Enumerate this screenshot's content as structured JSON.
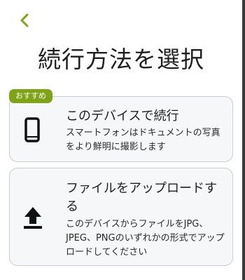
{
  "header": {
    "title": "続行方法を選択"
  },
  "options": [
    {
      "badge": "おすすめ",
      "title": "このデバイスで続行",
      "description": "スマートフォンはドキュメントの写真をより鮮明に撮影します",
      "icon": "smartphone-icon"
    },
    {
      "title": "ファイルをアップロードする",
      "description": "このデバイスからファイルをJPG、JPEG、PNGのいずれかの形式でアップロードしてください",
      "icon": "upload-icon"
    }
  ],
  "colors": {
    "accent": "#7fa316",
    "card_background": "#f6f7f8",
    "card_border": "#c9ccd0",
    "text": "#1f1f1f"
  }
}
